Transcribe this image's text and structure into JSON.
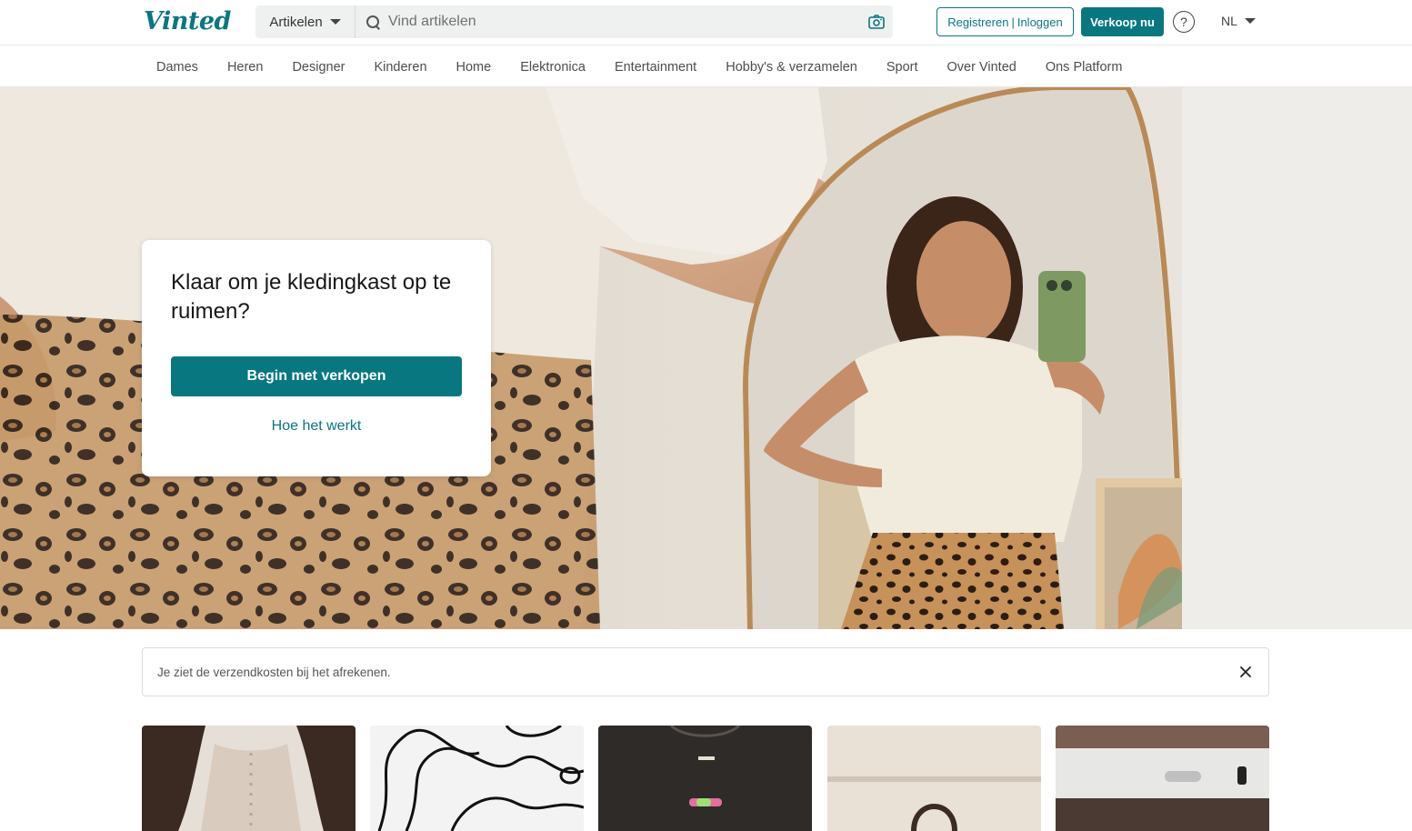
{
  "header": {
    "logo": "Vinted",
    "category_select": "Artikelen",
    "search_placeholder": "Vind artikelen",
    "register_label": "Registreren",
    "register_sep": "|",
    "login_label": "Inloggen",
    "sell_label": "Verkoop nu",
    "help_symbol": "?",
    "language": "NL",
    "accent_color": "#09777f"
  },
  "nav": {
    "items": [
      "Dames",
      "Heren",
      "Designer",
      "Kinderen",
      "Home",
      "Elektronica",
      "Entertainment",
      "Hobby's & verzamelen",
      "Sport",
      "Over Vinted",
      "Ons Platform"
    ]
  },
  "hero": {
    "title": "Klaar om je kledingkast op te ruimen?",
    "cta_label": "Begin met verkopen",
    "link_label": "Hoe het werkt"
  },
  "notice": {
    "text": "Je ziet de verzendkosten bij het afrekenen."
  },
  "icons": {
    "search": "search-icon",
    "camera": "camera-icon",
    "help": "help-icon",
    "dropdown": "chevron-down-icon",
    "close": "close-icon"
  },
  "items": [
    {
      "name": "item-1",
      "tone": "#e6dfd8"
    },
    {
      "name": "item-2",
      "tone": "#f3f3f3"
    },
    {
      "name": "item-3",
      "tone": "#2f2b29"
    },
    {
      "name": "item-4",
      "tone": "#e9e1d6"
    },
    {
      "name": "item-5",
      "tone": "#8a6b5f"
    }
  ]
}
